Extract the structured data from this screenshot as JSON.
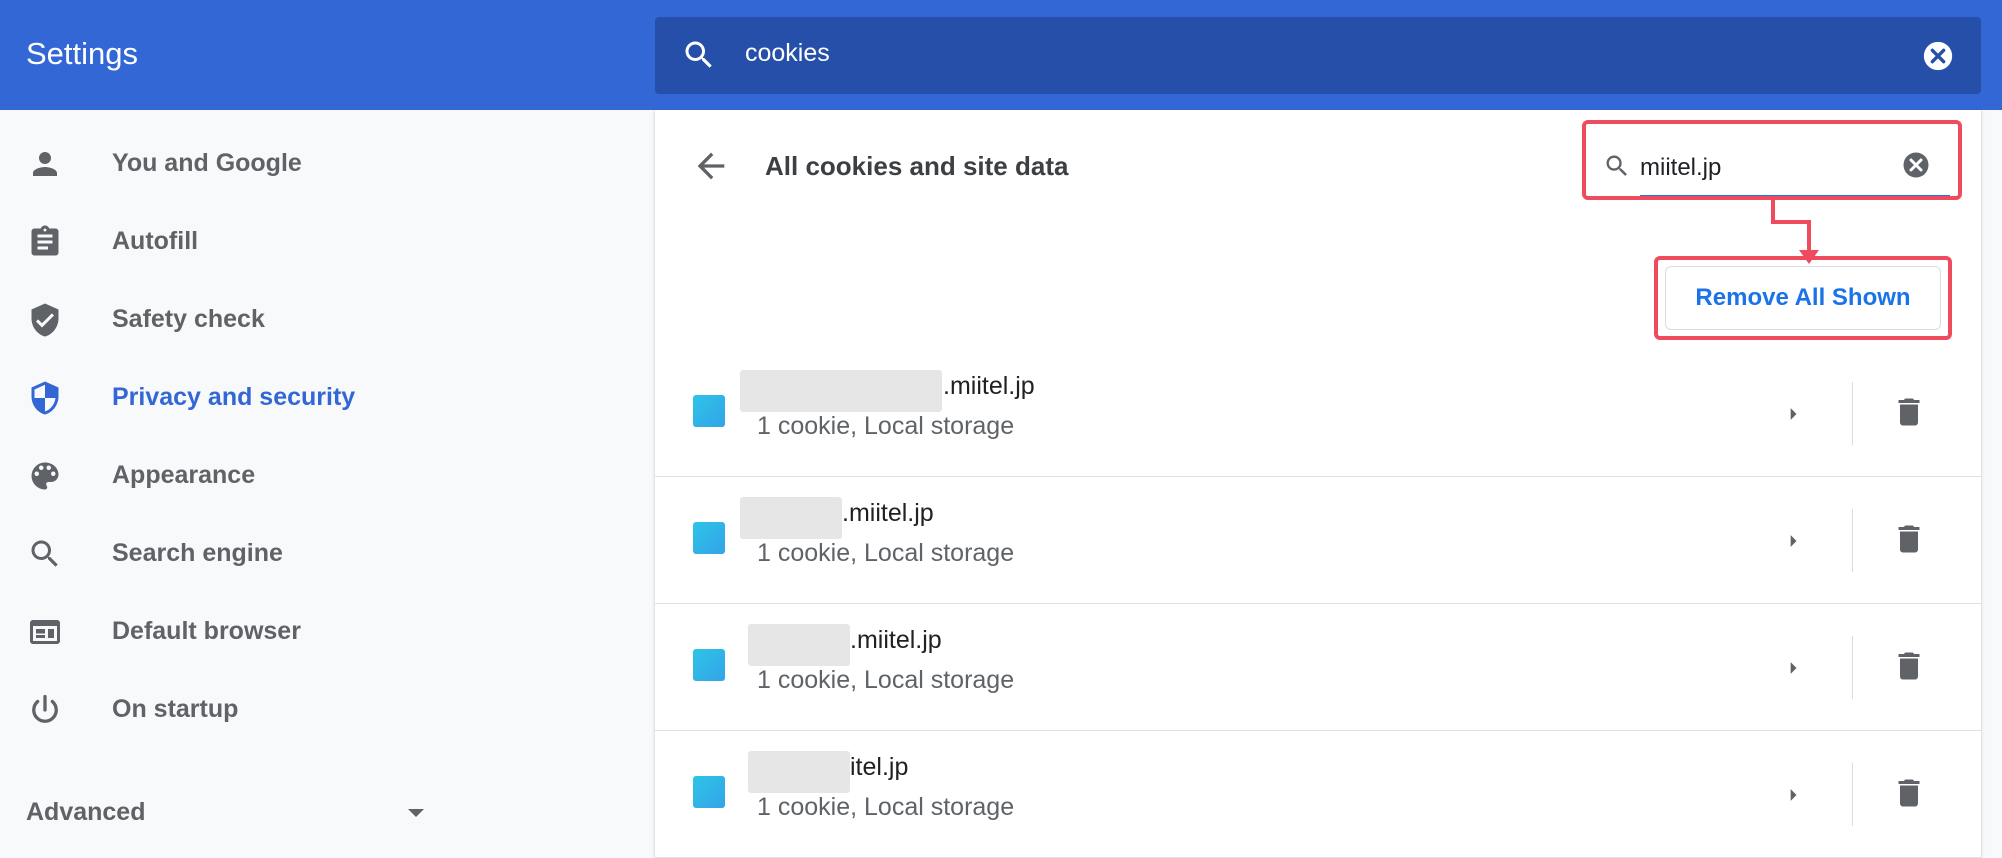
{
  "header": {
    "title": "Settings",
    "search_value": "cookies"
  },
  "sidebar": {
    "items": [
      {
        "label": "You and Google",
        "icon": "person-icon"
      },
      {
        "label": "Autofill",
        "icon": "clipboard-icon"
      },
      {
        "label": "Safety check",
        "icon": "shield-check-icon"
      },
      {
        "label": "Privacy and security",
        "icon": "shield-half-icon",
        "active": true
      },
      {
        "label": "Appearance",
        "icon": "palette-icon"
      },
      {
        "label": "Search engine",
        "icon": "search-icon"
      },
      {
        "label": "Default browser",
        "icon": "browser-window-icon"
      },
      {
        "label": "On startup",
        "icon": "power-icon"
      }
    ],
    "advanced_label": "Advanced"
  },
  "panel": {
    "title": "All cookies and site data",
    "filter_value": "miitel.jp",
    "remove_all_label": "Remove All Shown",
    "rows": [
      {
        "domain": ".miitel.jp",
        "desc": "1 cookie, Local storage"
      },
      {
        "domain": ".miitel.jp",
        "desc": "1 cookie, Local storage"
      },
      {
        "domain": ".miitel.jp",
        "desc": "1 cookie, Local storage"
      },
      {
        "domain": "itel.jp",
        "desc": "1 cookie, Local storage"
      }
    ]
  },
  "colors": {
    "header_bg": "#3367d6",
    "search_bg": "#254fa8",
    "accent": "#1a73e8",
    "highlight": "#ef4b5f"
  }
}
